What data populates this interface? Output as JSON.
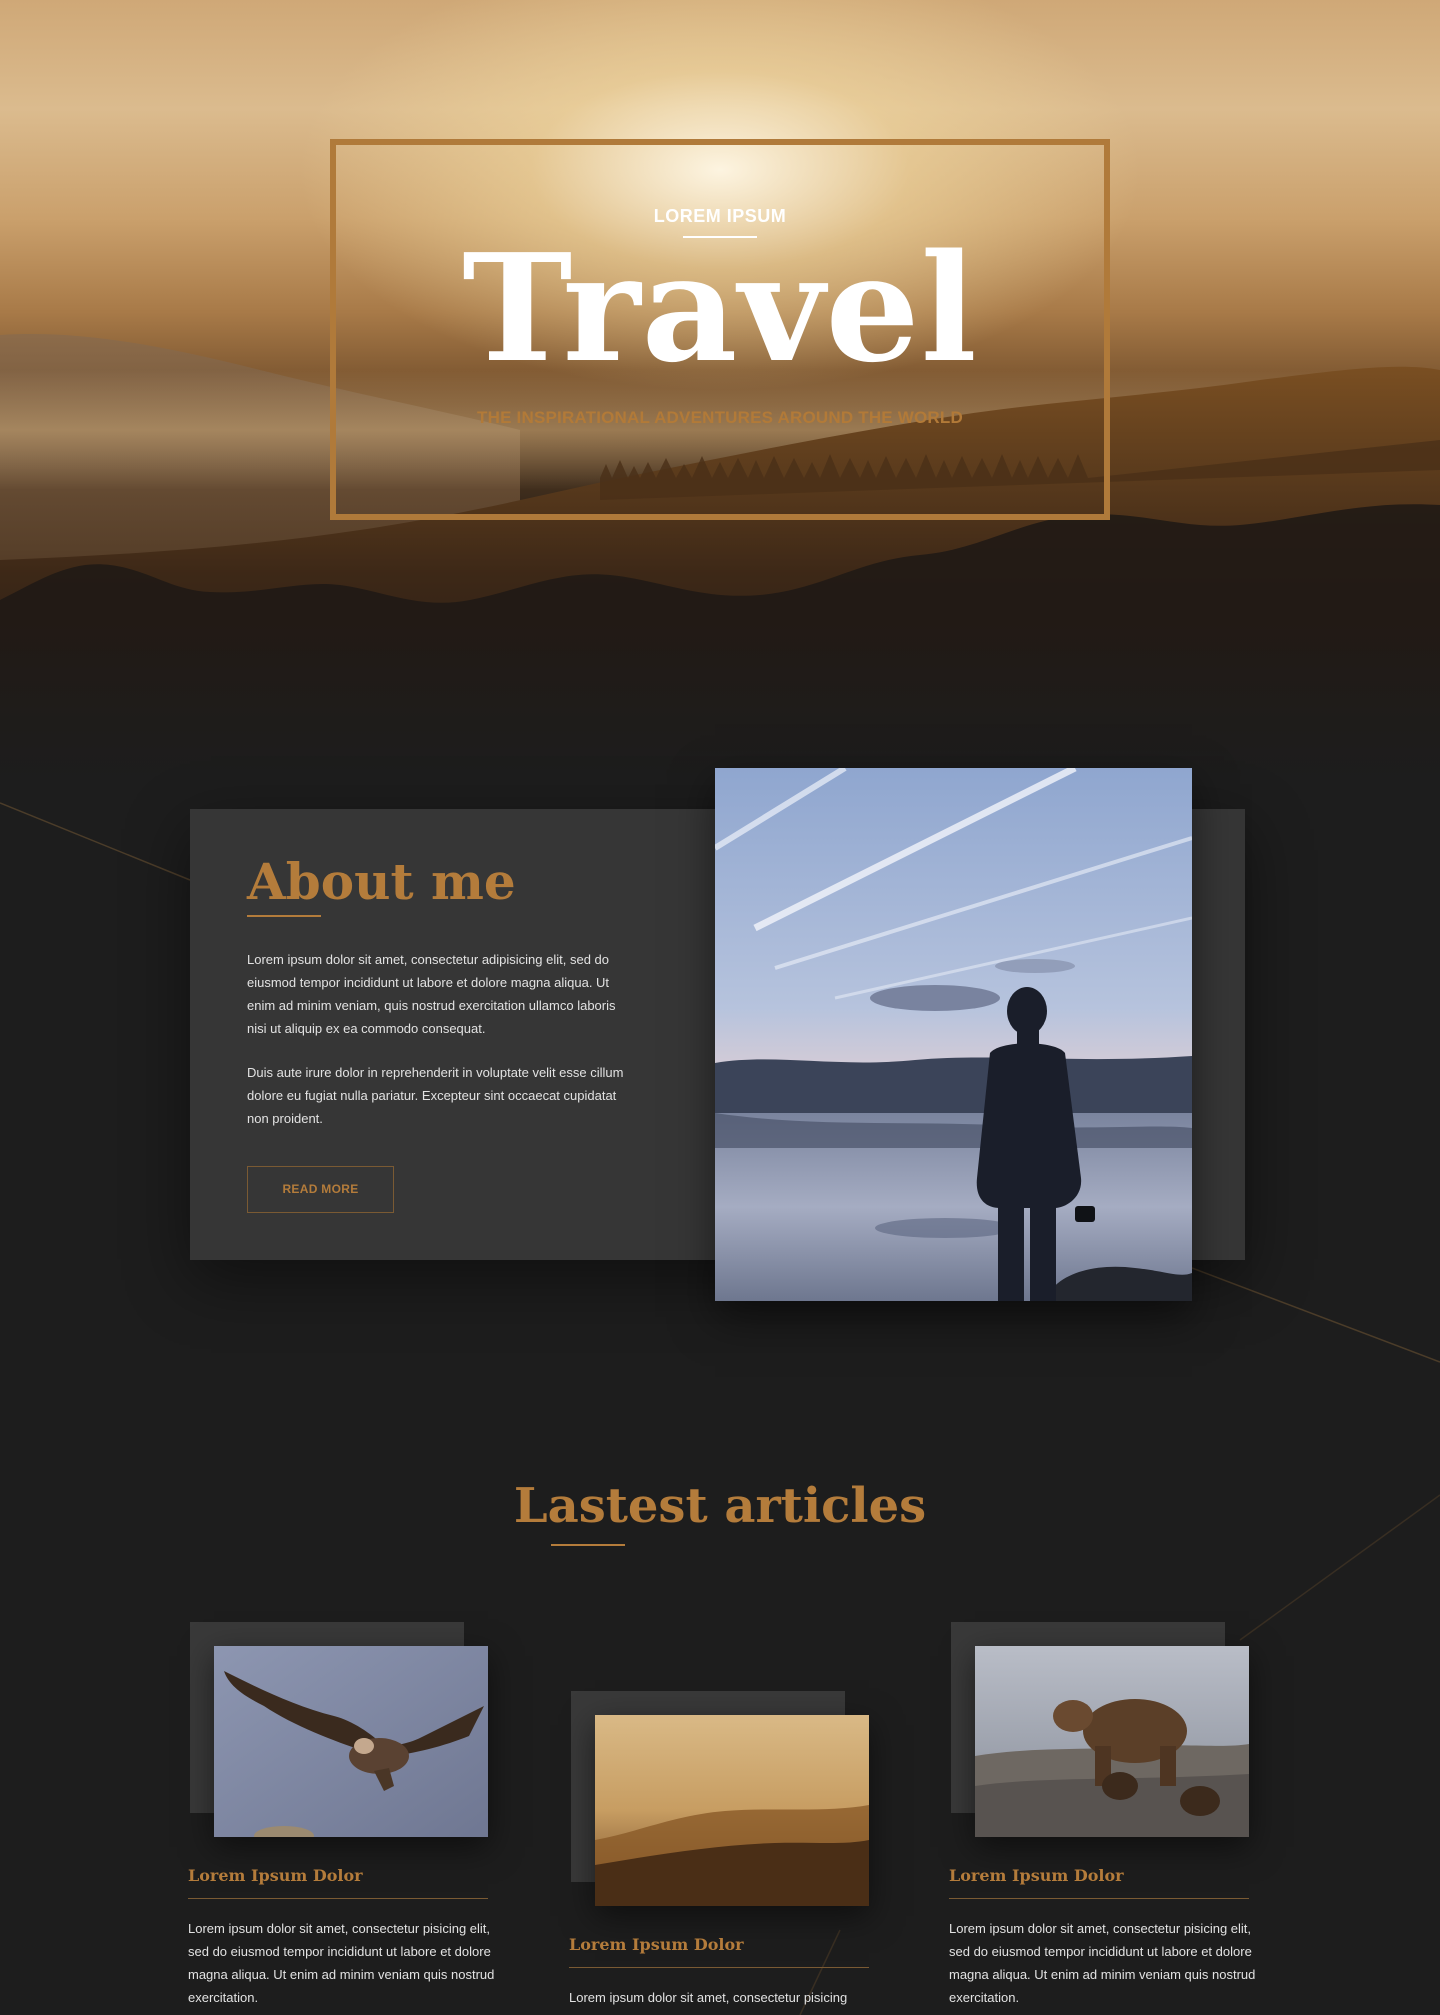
{
  "hero": {
    "kicker": "LOREM IPSUM",
    "title": "Travel",
    "tagline": "THE INSPIRATIONAL ADVENTURES AROUND THE WORLD"
  },
  "about": {
    "heading": "About me",
    "paragraph_1": "Lorem ipsum dolor sit amet, consectetur adipisicing elit, sed do eiusmod tempor incididunt ut labore et dolore magna aliqua. Ut enim ad minim veniam, quis nostrud exercitation ullamco laboris nisi ut aliquip ex ea commodo consequat.",
    "paragraph_2": "Duis aute irure dolor in reprehenderit in voluptate velit esse cillum dolore eu fugiat nulla pariatur. Excepteur sint occaecat cupidatat non proident.",
    "button_label": "READ MORE"
  },
  "articles": {
    "heading": "Lastest articles",
    "items": [
      {
        "title": "Lorem Ipsum Dolor",
        "excerpt": "Lorem ipsum dolor sit amet, consectetur pisicing elit, sed do eiusmod tempor incididunt ut labore et dolore magna aliqua. Ut enim ad minim veniam quis nostrud exercitation."
      },
      {
        "title": "Lorem Ipsum Dolor",
        "excerpt": "Lorem ipsum dolor sit amet, consectetur pisicing"
      },
      {
        "title": "Lorem Ipsum Dolor",
        "excerpt": "Lorem ipsum dolor sit amet, consectetur pisicing elit, sed do eiusmod tempor incididunt ut labore et dolore magna aliqua. Ut enim ad minim veniam quis nostrud exercitation."
      }
    ]
  },
  "colors": {
    "accent": "#b47c3b",
    "background": "#1d1d1d",
    "card": "#363636"
  }
}
